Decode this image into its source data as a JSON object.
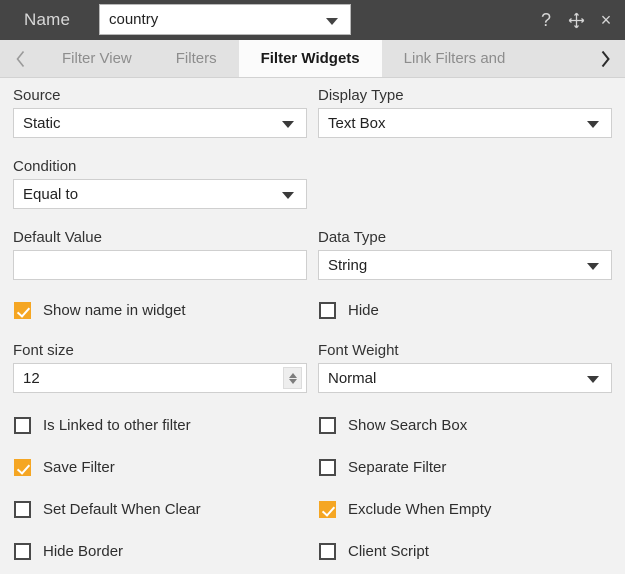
{
  "titlebar": {
    "name_label": "Name",
    "name_value": "country",
    "icons": [
      {
        "name": "help-icon",
        "glyph": "?"
      },
      {
        "name": "move-icon",
        "glyph": "move"
      },
      {
        "name": "close-icon",
        "glyph": "×"
      }
    ]
  },
  "tabbar": {
    "prev_arrow": "‹",
    "next_arrow": "›",
    "tabs": [
      {
        "label": "Filter View",
        "active": false
      },
      {
        "label": "Filters",
        "active": false
      },
      {
        "label": "Filter Widgets",
        "active": true
      },
      {
        "label": "Link Filters and",
        "active": false
      }
    ]
  },
  "form": {
    "source": {
      "label": "Source",
      "value": "Static"
    },
    "display_type": {
      "label": "Display Type",
      "value": "Text Box"
    },
    "condition": {
      "label": "Condition",
      "value": "Equal to"
    },
    "default_value": {
      "label": "Default Value",
      "value": "",
      "placeholder": ""
    },
    "data_type": {
      "label": "Data Type",
      "value": "String"
    },
    "font_size": {
      "label": "Font size",
      "value": "12"
    },
    "font_weight": {
      "label": "Font Weight",
      "value": "Normal"
    },
    "checkboxes": [
      {
        "label": "Show name in widget",
        "checked": true
      },
      {
        "label": "Hide",
        "checked": false
      },
      {
        "label": "Is Linked to other filter",
        "checked": false
      },
      {
        "label": "Show Search Box",
        "checked": false
      },
      {
        "label": "Save Filter",
        "checked": true
      },
      {
        "label": "Separate Filter",
        "checked": false
      },
      {
        "label": "Set Default When Clear",
        "checked": false
      },
      {
        "label": "Exclude When Empty",
        "checked": true
      },
      {
        "label": "Hide Border",
        "checked": false
      },
      {
        "label": "Client Script",
        "checked": false
      }
    ]
  },
  "colors": {
    "titlebar_bg": "#454545",
    "tabbar_bg": "#e2e2e2",
    "active_tab_bg": "#fbfbfb",
    "form_bg": "#f2f2f2",
    "checkbox_accent": "#f5a623"
  }
}
